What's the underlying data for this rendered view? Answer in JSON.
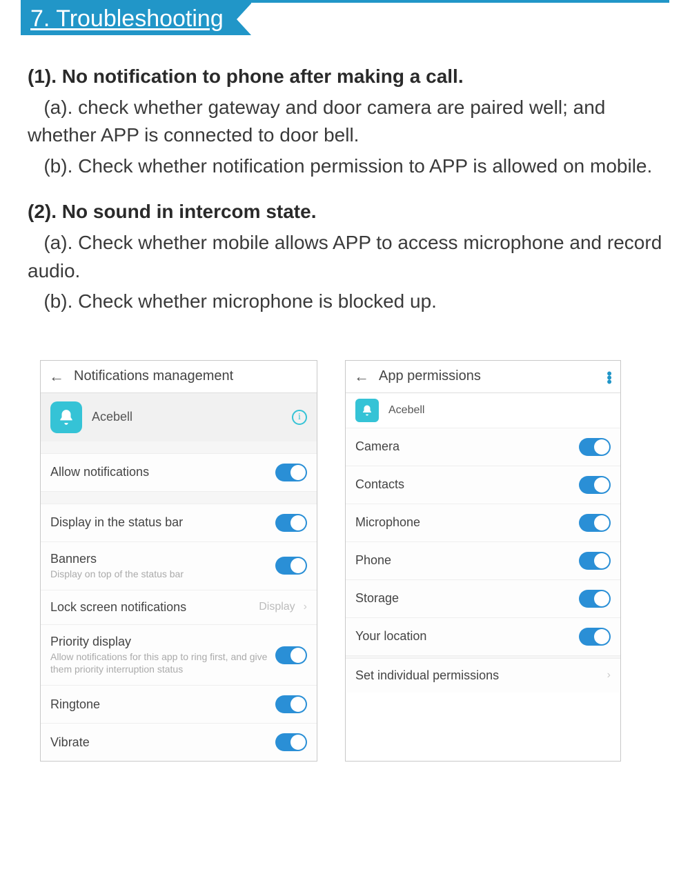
{
  "section_title": "7. Troubleshooting",
  "doc": {
    "q1_title": "(1). No notification to phone after making a call.",
    "q1_a_prefix": "(a). ",
    "q1_a": "check whether gateway and door camera are paired well; and whether APP is connected to door bell.",
    "q1_b_prefix": "(b). ",
    "q1_b": "Check whether notification permission to APP is allowed on mobile.",
    "q2_title": "(2). No sound in intercom state.",
    "q2_a_prefix": "(a). ",
    "q2_a": "Check whether mobile allows APP to access microphone and record audio.",
    "q2_b_prefix": "(b). ",
    "q2_b": "Check whether microphone is blocked up."
  },
  "left": {
    "title": "Notifications management",
    "app_name": "Acebell",
    "rows": {
      "allow": "Allow notifications",
      "status_bar": "Display in the status bar",
      "banners": "Banners",
      "banners_sub": "Display on top of the status bar",
      "lock": "Lock screen notifications",
      "lock_value": "Display",
      "priority": "Priority display",
      "priority_sub": "Allow notifications for this app to ring first, and give them priority interruption status",
      "ringtone": "Ringtone",
      "vibrate": "Vibrate"
    }
  },
  "right": {
    "title": "App permissions",
    "app_name": "Acebell",
    "perm_camera": "Camera",
    "perm_contacts": "Contacts",
    "perm_microphone": "Microphone",
    "perm_phone": "Phone",
    "perm_storage": "Storage",
    "perm_location": "Your location",
    "set_individual": "Set individual permissions"
  }
}
